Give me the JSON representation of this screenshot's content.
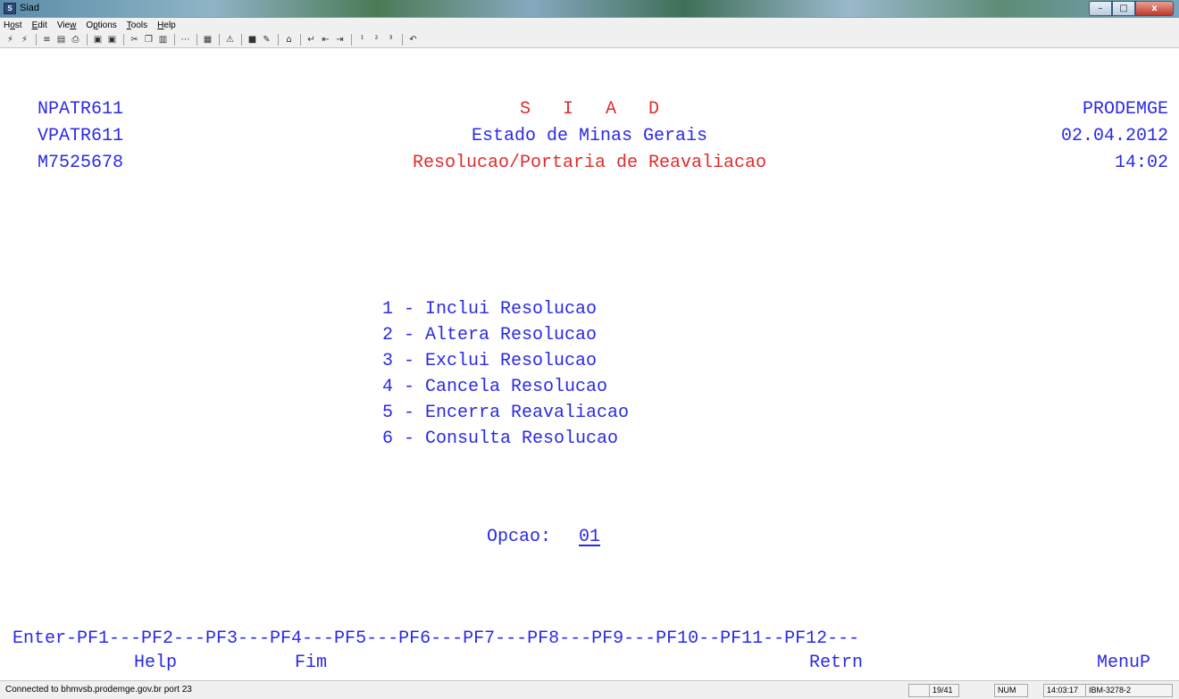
{
  "window": {
    "title": "Siad",
    "icon": "siad-app-icon",
    "controls": {
      "minimize": "–",
      "maximize": "□",
      "close": "x"
    }
  },
  "menubar": {
    "items": [
      {
        "label": "Host",
        "u": "o"
      },
      {
        "label": "Edit",
        "u": "E"
      },
      {
        "label": "View",
        "u": "w"
      },
      {
        "label": "Options",
        "u": "p"
      },
      {
        "label": "Tools",
        "u": "T"
      },
      {
        "label": "Help",
        "u": "H"
      }
    ]
  },
  "toolbar": {
    "icons": [
      "connect-icon",
      "disconnect-icon",
      "send-icon",
      "receive-icon",
      "print-icon",
      "new-session-icon",
      "copy-session-icon",
      "cut-icon",
      "copy-icon",
      "paste-icon",
      "dots-icon",
      "macro-icon",
      "alert-icon",
      "screen-icon",
      "keyboard-map-icon",
      "home-icon",
      "enter-icon",
      "field-back-icon",
      "field-forward-icon",
      "attn1-icon",
      "attn2-icon",
      "attn3-icon",
      "undo-icon"
    ]
  },
  "screen": {
    "header": {
      "program": "NPATR611",
      "view": "VPATR611",
      "user": "M7525678",
      "system": "S   I   A   D",
      "state": "Estado de Minas Gerais",
      "subtitle": "Resolucao/Portaria de Reavaliacao",
      "org": "PRODEMGE",
      "date": "02.04.2012",
      "time": "14:02"
    },
    "options": [
      "1 - Inclui Resolucao",
      "2 - Altera Resolucao",
      "3 - Exclui Resolucao",
      "4 - Cancela Resolucao",
      "5 - Encerra Reavaliacao",
      "6 - Consulta Resolucao"
    ],
    "opcao_label": "Opcao:",
    "opcao_value": "01",
    "pf_keys_line": "Enter-PF1---PF2---PF3---PF4---PF5---PF6---PF7---PF8---PF9---PF10--PF11--PF12---",
    "pf_help": "Help",
    "pf_fim": "Fim",
    "pf_retrn": "Retrn",
    "pf_menup": "MenuP"
  },
  "status": {
    "connection": "Connected to bhmvsb.prodemge.gov.br port 23",
    "cursor": "19/41",
    "num": "NUM",
    "clock": "14:03:17",
    "terminal_type": "IBM-3278-2"
  }
}
